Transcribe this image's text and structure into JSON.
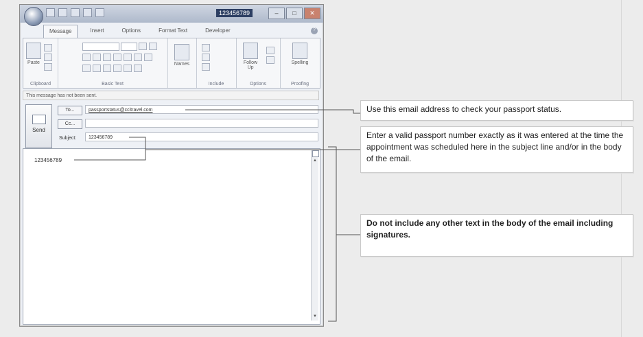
{
  "window": {
    "title": "123456789",
    "tabs": [
      "Message",
      "Insert",
      "Options",
      "Format Text",
      "Developer"
    ],
    "active_tab": "Message",
    "groups": {
      "clipboard": "Clipboard",
      "basic_text": "Basic Text",
      "include": "Include",
      "options": "Options",
      "proofing": "Proofing"
    },
    "buttons": {
      "paste": "Paste",
      "names": "Names",
      "follow_up": "Follow Up",
      "spelling": "Spelling"
    }
  },
  "message": {
    "info": "This message has not been sent.",
    "send_label": "Send",
    "to_label": "To...",
    "cc_label": "Cc...",
    "subject_label": "Subject:",
    "to_value": "passportstatus@ccitravel.com",
    "subject_value": "123456789",
    "body_value": "123456789"
  },
  "annotations": {
    "email": "Use this email address to check your passport status.",
    "passport": "Enter a valid passport number exactly as it was entered at the time the appointment was scheduled here in the subject line and/or in the body of the email.",
    "no_text": "Do not include any other text in the body of the email including signatures."
  },
  "colors": {
    "titlebar": "#aeb9cb",
    "title_highlight": "#2d3f63",
    "line": "#555555"
  }
}
